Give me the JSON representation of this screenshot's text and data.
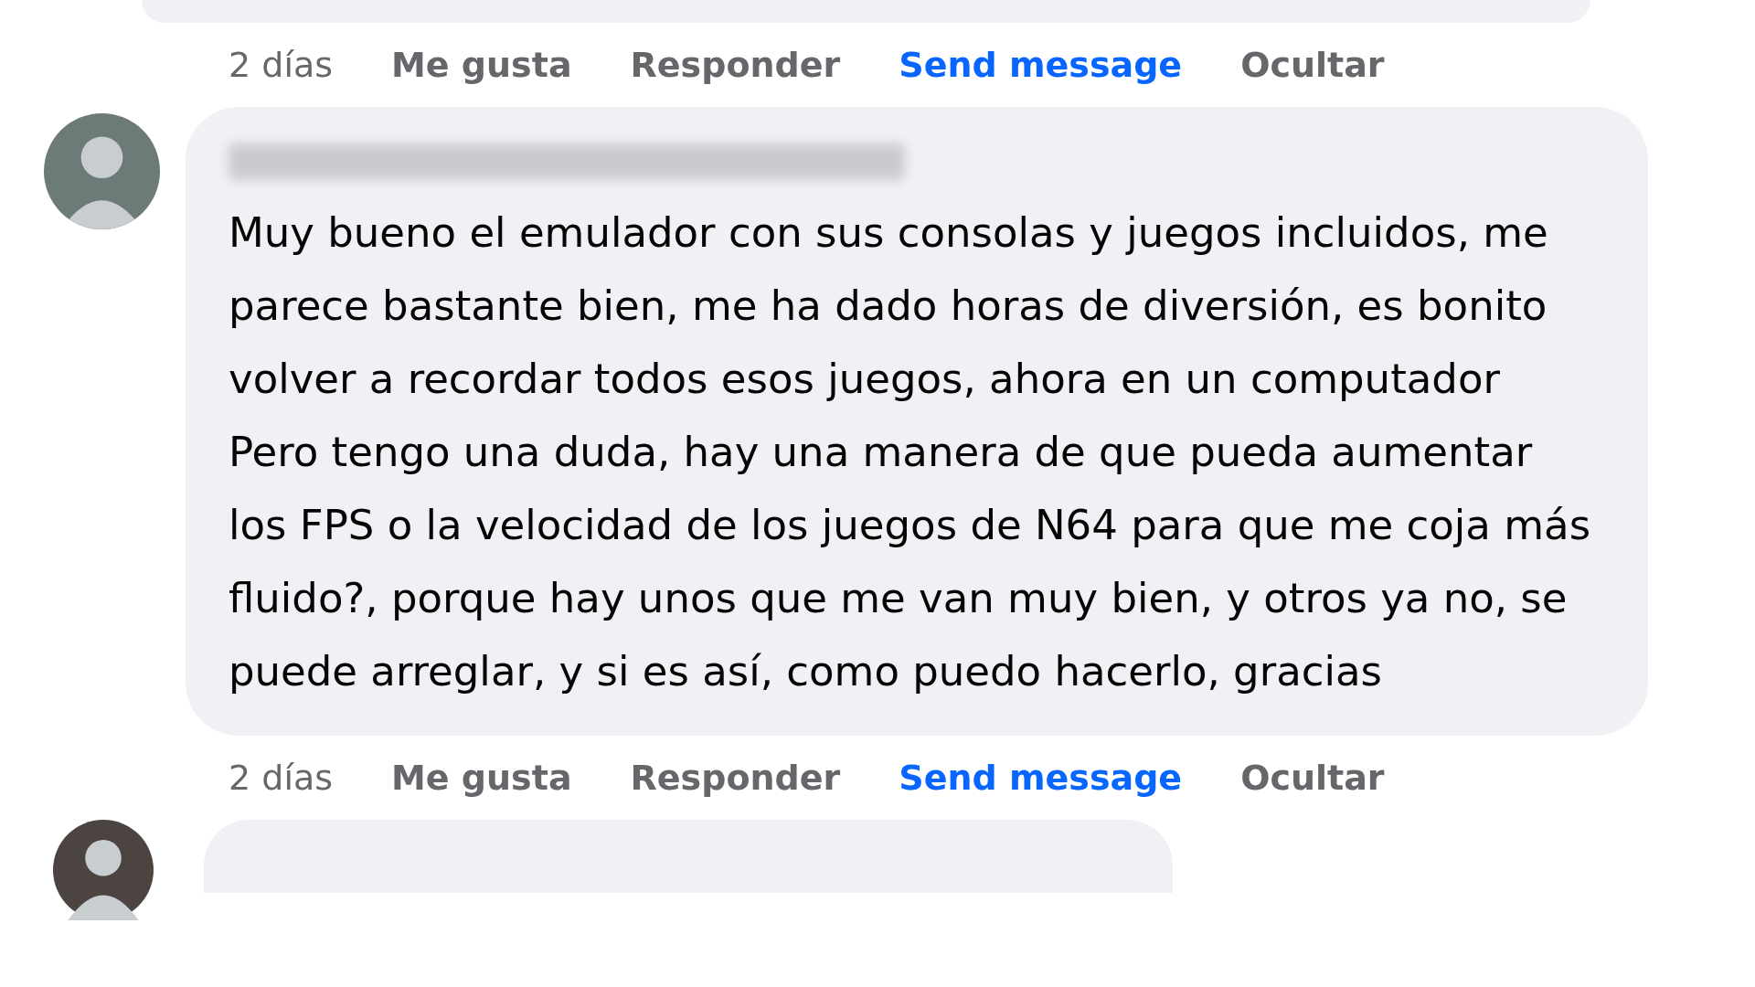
{
  "comments": [
    {
      "kind": "previous",
      "actions": [
        {
          "label": "2 días",
          "kind": "time"
        },
        {
          "label": "Me gusta",
          "kind": "action"
        },
        {
          "label": "Responder",
          "kind": "action"
        },
        {
          "label": "Send message",
          "kind": "link"
        },
        {
          "label": "Ocultar",
          "kind": "action"
        }
      ]
    },
    {
      "kind": "full",
      "paragraphs": [
        "Muy bueno el emulador con sus consolas y juegos incluidos, me parece bastante bien, me ha dado horas de diversión, es bonito volver a recordar todos esos juegos, ahora en un computador",
        "Pero tengo una duda, hay una manera de que pueda aumentar los FPS o la velocidad de los juegos de N64 para que me coja más fluido?, porque hay unos que me van muy bien, y otros ya no, se puede arreglar, y si es así, como puedo hacerlo, gracias"
      ],
      "actions": [
        {
          "label": "2 días",
          "kind": "time"
        },
        {
          "label": "Me gusta",
          "kind": "action"
        },
        {
          "label": "Responder",
          "kind": "action"
        },
        {
          "label": "Send message",
          "kind": "link"
        },
        {
          "label": "Ocultar",
          "kind": "action"
        }
      ]
    },
    {
      "kind": "next"
    }
  ]
}
